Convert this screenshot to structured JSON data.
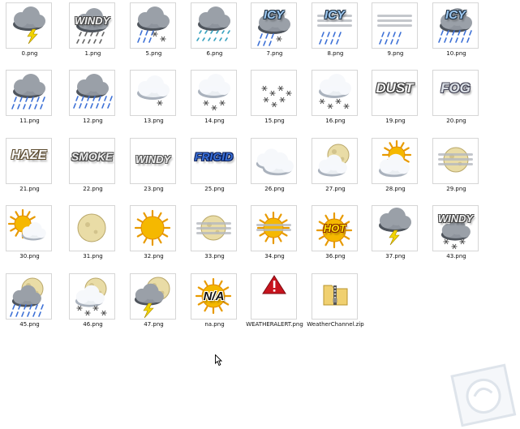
{
  "files": [
    {
      "name": "0.png",
      "icon": "thunderstorm-icon"
    },
    {
      "name": "1.png",
      "icon": "windy-cloud-icon",
      "word": "WINDY"
    },
    {
      "name": "5.png",
      "icon": "rain-snow-icon"
    },
    {
      "name": "6.png",
      "icon": "freezing-drizzle-icon"
    },
    {
      "name": "7.png",
      "icon": "icy-mix-icon",
      "word": "ICY"
    },
    {
      "name": "8.png",
      "icon": "icy-rain-icon",
      "word": "ICY"
    },
    {
      "name": "9.png",
      "icon": "drizzle-fog-icon"
    },
    {
      "name": "10.png",
      "icon": "icy-heavy-rain-icon",
      "word": "ICY"
    },
    {
      "name": "11.png",
      "icon": "rain-icon"
    },
    {
      "name": "12.png",
      "icon": "heavy-rain-icon"
    },
    {
      "name": "13.png",
      "icon": "light-snow-icon"
    },
    {
      "name": "14.png",
      "icon": "snow-icon"
    },
    {
      "name": "15.png",
      "icon": "snowflakes-icon"
    },
    {
      "name": "16.png",
      "icon": "heavy-snow-icon"
    },
    {
      "name": "19.png",
      "icon": "dust-icon",
      "word": "DUST"
    },
    {
      "name": "20.png",
      "icon": "fog-icon",
      "word": "FOG"
    },
    {
      "name": "21.png",
      "icon": "haze-icon",
      "word": "HAZE"
    },
    {
      "name": "22.png",
      "icon": "smoke-icon",
      "word": "SMOKE"
    },
    {
      "name": "23.png",
      "icon": "windy-icon",
      "word": "WINDY"
    },
    {
      "name": "25.png",
      "icon": "frigid-icon",
      "word": "FRIGID"
    },
    {
      "name": "26.png",
      "icon": "cloudy-icon"
    },
    {
      "name": "27.png",
      "icon": "mostly-cloudy-night-icon"
    },
    {
      "name": "28.png",
      "icon": "mostly-cloudy-day-icon"
    },
    {
      "name": "29.png",
      "icon": "partly-cloudy-night-icon"
    },
    {
      "name": "30.png",
      "icon": "partly-cloudy-day-icon"
    },
    {
      "name": "31.png",
      "icon": "clear-night-icon"
    },
    {
      "name": "32.png",
      "icon": "sunny-icon"
    },
    {
      "name": "33.png",
      "icon": "fair-night-icon"
    },
    {
      "name": "34.png",
      "icon": "fair-day-icon"
    },
    {
      "name": "36.png",
      "icon": "hot-icon",
      "word": "HOT"
    },
    {
      "name": "37.png",
      "icon": "isolated-thunder-icon"
    },
    {
      "name": "43.png",
      "icon": "windy-snow-icon",
      "word": "WINDY"
    },
    {
      "name": "45.png",
      "icon": "night-rain-icon"
    },
    {
      "name": "46.png",
      "icon": "night-snow-icon"
    },
    {
      "name": "47.png",
      "icon": "night-thunder-icon"
    },
    {
      "name": "na.png",
      "icon": "not-available-icon",
      "word": "N/A"
    },
    {
      "name": "WEATHERALERT.png",
      "icon": "weather-alert-icon"
    },
    {
      "name": "WeatherChannel.zip",
      "icon": "zip-folder-icon"
    }
  ],
  "colors": {
    "cloud": "#8e949c",
    "cloud_light": "#e4e7ec",
    "rain": "#3b6fd6",
    "sun": "#f5b800",
    "moon": "#e9dca6",
    "bolt": "#f2d400",
    "alert": "#c8141e"
  }
}
